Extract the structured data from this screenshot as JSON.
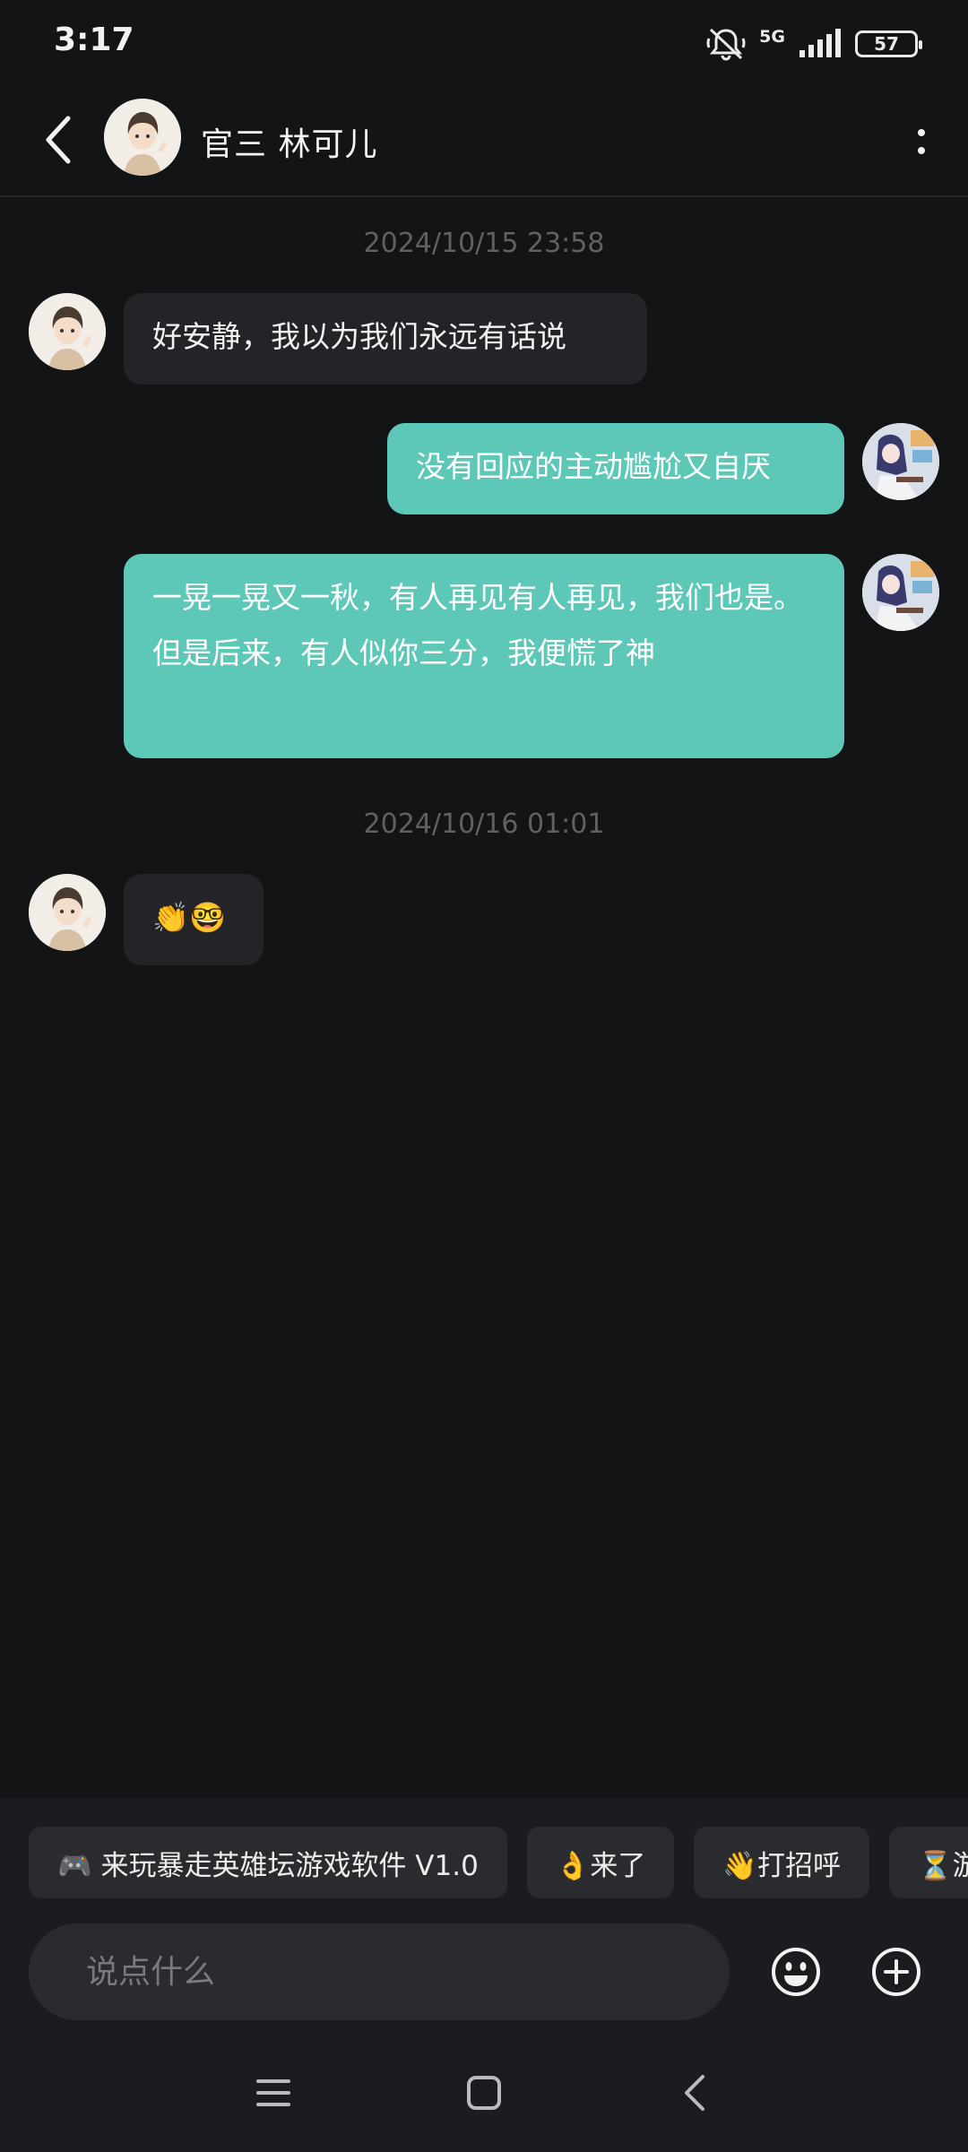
{
  "status_bar": {
    "time": "3:17",
    "network": "5G",
    "battery": "57",
    "icons": [
      "mute-bell-icon",
      "signal-icon",
      "battery-icon"
    ]
  },
  "header": {
    "title": "官三 林可儿",
    "back_icon": "chevron-left-icon",
    "more_icon": "more-vertical-icon"
  },
  "conversation": {
    "timestamps": [
      "2024/10/15  23:58",
      "2024/10/16  01:01"
    ],
    "messages": [
      {
        "from": "them",
        "text": "好安静，我以为我们永远有话说"
      },
      {
        "from": "me",
        "text": "没有回应的主动尴尬又自厌"
      },
      {
        "from": "me",
        "text": "一晃一晃又一秋，有人再见有人再见，我们也是。但是后来，有人似你三分，我便慌了神"
      },
      {
        "from": "them",
        "text": "👏🤓"
      }
    ]
  },
  "quick_replies": [
    "🎮 来玩暴走英雄坛游戏软件 V1.0",
    "👌来了",
    "👋打招呼",
    "⏳游"
  ],
  "composer": {
    "placeholder": "说点什么",
    "emoji_icon": "smiley-icon",
    "plus_icon": "plus-circle-icon"
  },
  "nav_bar": {
    "icons": [
      "menu-icon",
      "home-square-icon",
      "back-chevron-icon"
    ]
  },
  "colors": {
    "background": "#131415",
    "incoming_bubble": "#232427",
    "outgoing_bubble": "#5ec8b8"
  }
}
